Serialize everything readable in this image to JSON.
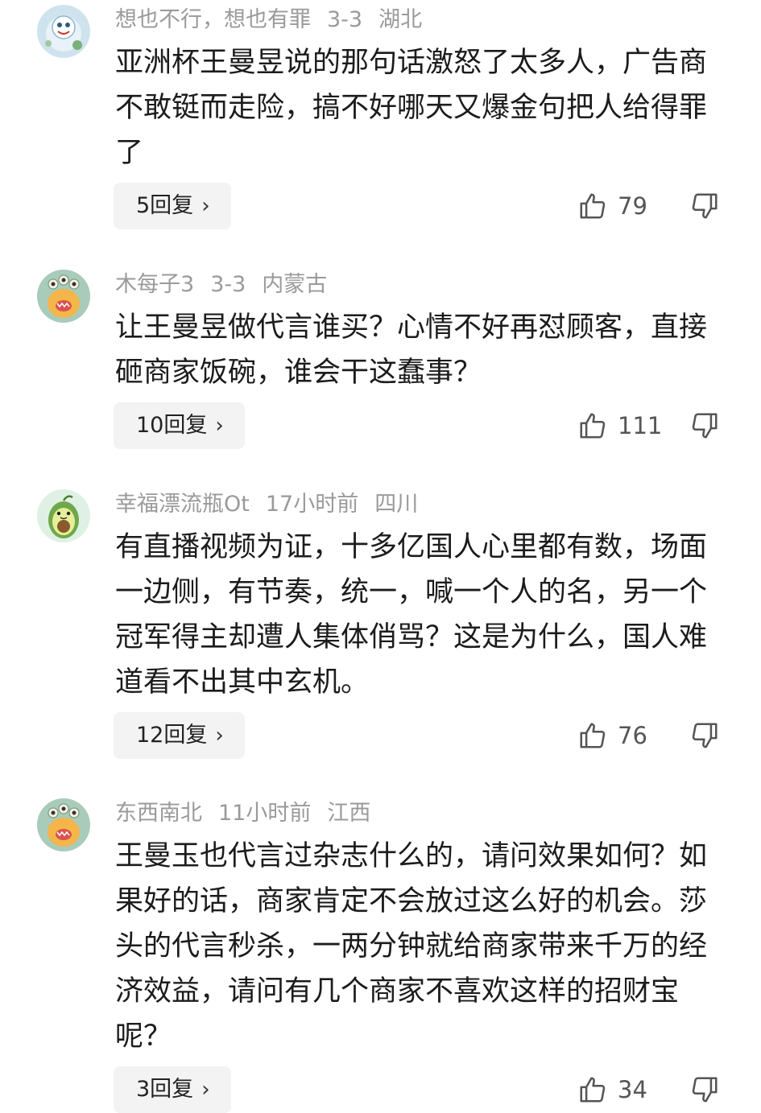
{
  "comments": [
    {
      "username": "想也不行，想也有罪",
      "date": "3-3",
      "location": "湖北",
      "text": "亚洲杯王曼昱说的那句话激怒了太多人，广告商不敢铤而走险，搞不好哪天又爆金句把人给得罪了",
      "replies_label": "5回复",
      "likes": "79",
      "avatar_icon": "doraemon-avatar"
    },
    {
      "username": "木每子3",
      "date": "3-3",
      "location": "内蒙古",
      "text": "让王曼昱做代言谁买？心情不好再怼顾客，直接砸商家饭碗，谁会干这蠢事？",
      "replies_label": "10回复",
      "likes": "111",
      "avatar_icon": "monster-avatar"
    },
    {
      "username": "幸福漂流瓶Ot",
      "date": "17小时前",
      "location": "四川",
      "text": "有直播视频为证，十多亿国人心里都有数，场面一边侧，有节奏，统一，喊一个人的名，另一个冠军得主却遭人集体俏骂？这是为什么，国人难道看不出其中玄机。",
      "replies_label": "12回复",
      "likes": "76",
      "avatar_icon": "avocado-avatar"
    },
    {
      "username": "东西南北",
      "date": "11小时前",
      "location": "江西",
      "text": "王曼玉也代言过杂志什么的，请问效果如何？如果好的话，商家肯定不会放过这么好的机会。莎头的代言秒杀，一两分钟就给商家带来千万的经济效益，请问有几个商家不喜欢这样的招财宝呢？",
      "replies_label": "3回复",
      "likes": "34",
      "avatar_icon": "monster-avatar"
    }
  ]
}
